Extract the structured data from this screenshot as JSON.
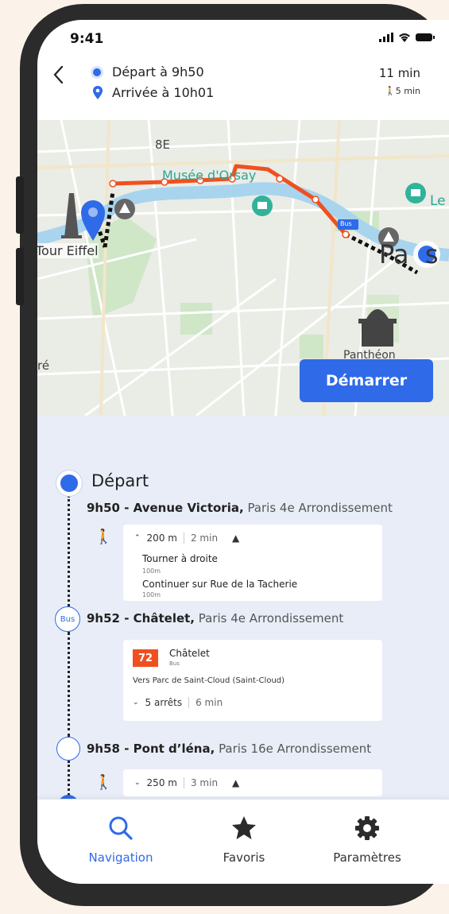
{
  "status": {
    "time": "9:41"
  },
  "header": {
    "departure": "Départ à 9h50",
    "arrival": "Arrivée à 10h01",
    "duration": "11 min",
    "walk_time": "5 min"
  },
  "map": {
    "labels": {
      "arrondissement": "8E",
      "musee": "Musée d'Orsay",
      "eiffel": "Tour Eiffel",
      "paris": "Pa  s",
      "pantheon": "Panthéon",
      "left_edge": "ré",
      "louvre": "Le",
      "bus_tag": "Bus"
    },
    "colors": {
      "route": "#f0501f",
      "primary": "#2f6ae8",
      "water": "#a8d4ee"
    }
  },
  "start_button": "Démarrer",
  "itinerary": {
    "departure_title": "Départ",
    "stops": [
      {
        "time_place": "9h50 - Avenue Victoria,",
        "area": "Paris 4e Arrondissement"
      },
      {
        "time_place": "9h52 - Châtelet,",
        "area": "Paris 4e Arrondissement"
      },
      {
        "time_place": "9h58 - Pont d’léna,",
        "area": "Paris 16e Arrondissement"
      }
    ],
    "bus_badge": "Bus",
    "walk1": {
      "distance": "200 m",
      "time": "2 min",
      "steps": [
        {
          "instruction": "Tourner à droite",
          "distance": "100m"
        },
        {
          "instruction": "Continuer sur Rue de la Tacherie",
          "distance": "100m"
        }
      ]
    },
    "bus": {
      "line": "72",
      "stop": "Châtelet",
      "mode": "Bus",
      "direction": "Vers Parc de Saint-Cloud (Saint-Cloud)",
      "stops_count": "5 arrêts",
      "time": "6 min"
    },
    "walk2": {
      "distance": "250 m",
      "time": "3 min"
    }
  },
  "nav": {
    "items": [
      {
        "label": "Navigation",
        "icon": "search-icon",
        "active": true
      },
      {
        "label": "Favoris",
        "icon": "star-icon",
        "active": false
      },
      {
        "label": "Paramètres",
        "icon": "gear-icon",
        "active": false
      }
    ]
  }
}
